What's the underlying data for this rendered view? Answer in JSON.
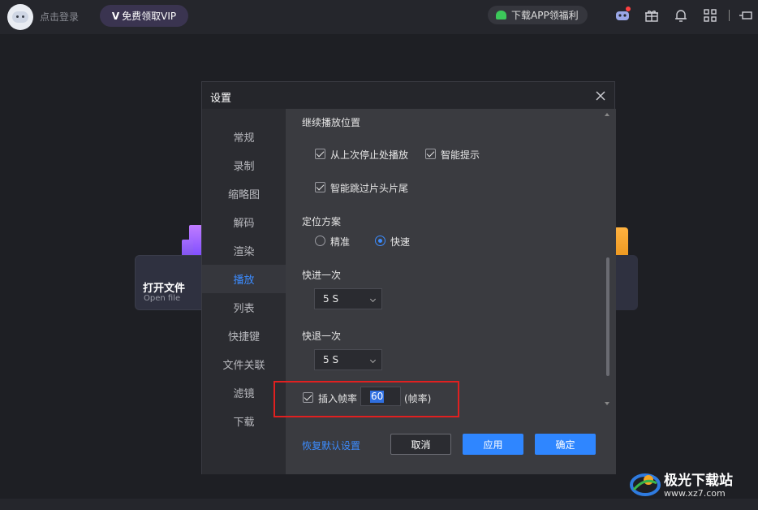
{
  "topbar": {
    "login_label": "点击登录",
    "vip_prefix": "V",
    "vip_label": "免费领取VIP",
    "download_label": "下载APP领福利",
    "icons": [
      "android-icon",
      "game-icon",
      "gift-icon",
      "bell-icon",
      "grid-icon",
      "pin-icon"
    ]
  },
  "home": {
    "open_file_title": "打开文件",
    "open_file_subtitle": "Open file"
  },
  "dialog": {
    "title": "设置",
    "nav": [
      "常规",
      "录制",
      "缩略图",
      "解码",
      "渲染",
      "播放",
      "列表",
      "快捷键",
      "文件关联",
      "滤镜",
      "下载"
    ],
    "active_nav": "播放",
    "section_resume": "继续播放位置",
    "resume_from_last": "从上次停止处播放",
    "smart_hint": "智能提示",
    "skip_intro_outro": "智能跳过片头片尾",
    "section_seek": "定位方案",
    "seek_precise": "精准",
    "seek_fast": "快速",
    "seek_selected": "快速",
    "forward_label": "快进一次",
    "forward_value": "5 S",
    "backward_label": "快退一次",
    "backward_value": "5 S",
    "insert_frame_label": "插入帧率",
    "insert_frame_value": "60",
    "insert_frame_unit": "(帧率)",
    "restore_defaults": "恢复默认设置",
    "cancel": "取消",
    "apply": "应用",
    "ok": "确定"
  },
  "watermark": {
    "text": "极光下载站",
    "url": "www.xz7.com"
  },
  "colors": {
    "accent": "#2f86ff",
    "highlight_border": "#e02020"
  }
}
